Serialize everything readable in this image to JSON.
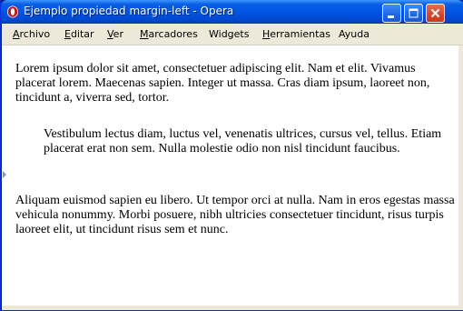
{
  "window": {
    "title": "Ejemplo propiedad margin-left - Opera",
    "controls": {
      "minimize": "minimize-icon",
      "maximize": "maximize-icon",
      "close": "close-icon"
    }
  },
  "menubar": {
    "items": [
      {
        "accel": "A",
        "rest": "rchivo"
      },
      {
        "accel": "E",
        "rest": "ditar"
      },
      {
        "accel": "V",
        "rest": "er"
      },
      {
        "accel": "M",
        "rest": "arcadores"
      },
      {
        "accel": "",
        "rest": "Widgets"
      },
      {
        "accel": "H",
        "rest": "erramientas"
      },
      {
        "accel": "",
        "rest": "Ayuda"
      }
    ]
  },
  "content": {
    "paragraphs": [
      "Lorem ipsum dolor sit amet, consectetuer adipiscing elit. Nam et elit. Vivamus placerat lorem. Maecenas sapien. Integer ut massa. Cras diam ipsum, laoreet non, tincidunt a, viverra sed, tortor.",
      "Vestibulum lectus diam, luctus vel, venenatis ultrices, cursus vel, tellus. Etiam placerat erat non sem. Nulla molestie odio non nisl tincidunt faucibus.",
      "Aliquam euismod sapien eu libero. Ut tempor orci at nulla. Nam in eros egestas massa vehicula nonummy. Morbi posuere, nibh ultricies consectetuer tincidunt, risus turpis laoreet elit, ut tincidunt risus sem et nunc."
    ]
  }
}
